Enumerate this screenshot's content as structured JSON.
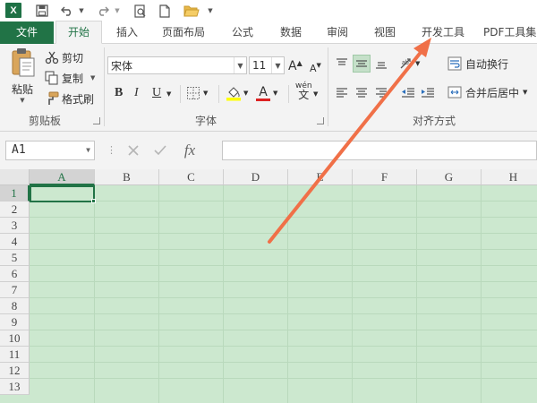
{
  "app": {
    "logo_letter": "X"
  },
  "tabs": [
    {
      "label": "文件"
    },
    {
      "label": "开始"
    },
    {
      "label": "插入"
    },
    {
      "label": "页面布局"
    },
    {
      "label": "公式"
    },
    {
      "label": "数据"
    },
    {
      "label": "审阅"
    },
    {
      "label": "视图"
    },
    {
      "label": "开发工具"
    },
    {
      "label": "PDF工具集"
    }
  ],
  "ribbon": {
    "clipboard": {
      "paste_label": "粘贴",
      "cut_label": "剪切",
      "copy_label": "复制",
      "format_painter_label": "格式刷",
      "group_label": "剪贴板"
    },
    "font": {
      "font_name": "宋体",
      "font_size": "11",
      "grow_label": "A",
      "shrink_label": "A",
      "bold_label": "B",
      "italic_label": "I",
      "underline_label": "U",
      "font_color_label": "A",
      "phonetic_label": "wén",
      "group_label": "字体"
    },
    "alignment": {
      "wrap_text_label": "自动换行",
      "merge_center_label": "合并后居中",
      "group_label": "对齐方式"
    }
  },
  "formula_bar": {
    "name_box": "A1",
    "fx_label": "fx"
  },
  "grid": {
    "columns": [
      "A",
      "B",
      "C",
      "D",
      "E",
      "F",
      "G",
      "H"
    ],
    "rows": [
      "1",
      "2",
      "3",
      "4",
      "5",
      "6",
      "7",
      "8",
      "9",
      "10",
      "11",
      "12",
      "13"
    ],
    "active_cell": "A1"
  },
  "colors": {
    "brand": "#217346",
    "sheet_background": "#cce8cf",
    "arrow": "#f07048"
  }
}
